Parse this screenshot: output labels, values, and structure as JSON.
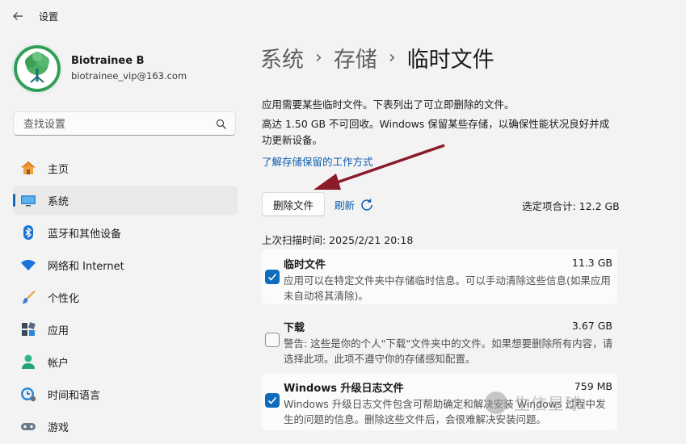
{
  "app": {
    "title": "设置"
  },
  "user": {
    "name": "Biotrainee B",
    "email": "biotrainee_vip@163.com"
  },
  "search": {
    "placeholder": "查找设置"
  },
  "nav": {
    "items": [
      {
        "label": "主页",
        "icon": "home-icon"
      },
      {
        "label": "系统",
        "icon": "system-icon",
        "active": true
      },
      {
        "label": "蓝牙和其他设备",
        "icon": "bluetooth-icon"
      },
      {
        "label": "网络和 Internet",
        "icon": "wifi-icon"
      },
      {
        "label": "个性化",
        "icon": "brush-icon"
      },
      {
        "label": "应用",
        "icon": "apps-icon"
      },
      {
        "label": "帐户",
        "icon": "account-icon"
      },
      {
        "label": "时间和语言",
        "icon": "clock-globe-icon"
      },
      {
        "label": "游戏",
        "icon": "gamepad-icon"
      }
    ]
  },
  "breadcrumb": {
    "part1": "系统",
    "part2": "存储",
    "current": "临时文件",
    "separator": "›"
  },
  "main": {
    "desc1": "应用需要某些临时文件。下表列出了可立即删除的文件。",
    "desc2": "高达 1.50 GB 不可回收。Windows 保留某些存储，以确保性能状况良好并成功更新设备。",
    "learn_link": "了解存储保留的工作方式",
    "delete_button": "删除文件",
    "refresh_label": "刷新",
    "selected_total": "选定项合计: 12.2 GB",
    "last_scan": "上次扫描时间: 2025/2/21 20:18"
  },
  "files": [
    {
      "name": "临时文件",
      "size": "11.3 GB",
      "checked": true,
      "desc": "应用可以在特定文件夹中存储临时信息。可以手动清除这些信息(如果应用未自动将其清除)。"
    },
    {
      "name": "下载",
      "size": "3.67 GB",
      "checked": false,
      "desc": "警告: 这些是你的个人\"下载\"文件夹中的文件。如果想要删除所有内容，请选择此项。此项不遵守你的存储感知配置。"
    },
    {
      "name": "Windows 升级日志文件",
      "size": "759 MB",
      "checked": true,
      "desc": "Windows 升级日志文件包含可帮助确定和解决安装 Windows 过程中发生的问题的信息。删除这些文件后，会很难解决安装问题。"
    }
  ],
  "watermark": {
    "text": "生信星球"
  },
  "colors": {
    "accent": "#0f6cbd",
    "link": "#0b5cad",
    "arrow": "#8b1a2b",
    "background": "#f3f3f3"
  }
}
